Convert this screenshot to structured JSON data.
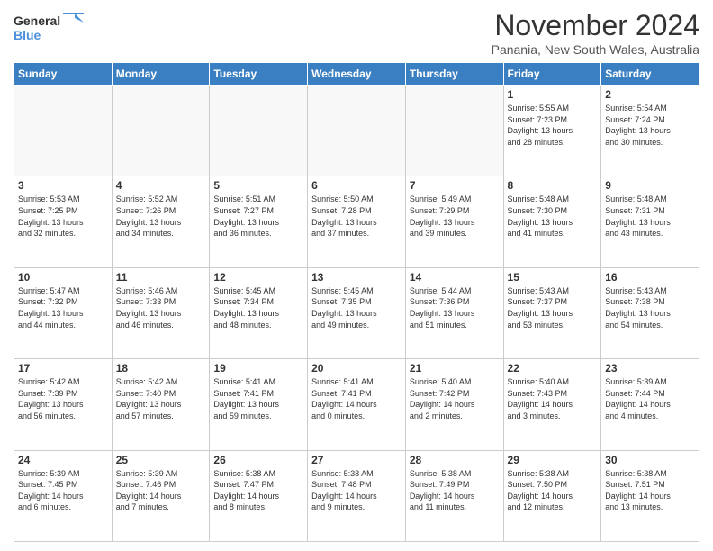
{
  "logo": {
    "line1": "General",
    "line2": "Blue"
  },
  "header": {
    "month": "November 2024",
    "location": "Panania, New South Wales, Australia"
  },
  "weekdays": [
    "Sunday",
    "Monday",
    "Tuesday",
    "Wednesday",
    "Thursday",
    "Friday",
    "Saturday"
  ],
  "weeks": [
    [
      {
        "day": "",
        "info": ""
      },
      {
        "day": "",
        "info": ""
      },
      {
        "day": "",
        "info": ""
      },
      {
        "day": "",
        "info": ""
      },
      {
        "day": "",
        "info": ""
      },
      {
        "day": "1",
        "info": "Sunrise: 5:55 AM\nSunset: 7:23 PM\nDaylight: 13 hours\nand 28 minutes."
      },
      {
        "day": "2",
        "info": "Sunrise: 5:54 AM\nSunset: 7:24 PM\nDaylight: 13 hours\nand 30 minutes."
      }
    ],
    [
      {
        "day": "3",
        "info": "Sunrise: 5:53 AM\nSunset: 7:25 PM\nDaylight: 13 hours\nand 32 minutes."
      },
      {
        "day": "4",
        "info": "Sunrise: 5:52 AM\nSunset: 7:26 PM\nDaylight: 13 hours\nand 34 minutes."
      },
      {
        "day": "5",
        "info": "Sunrise: 5:51 AM\nSunset: 7:27 PM\nDaylight: 13 hours\nand 36 minutes."
      },
      {
        "day": "6",
        "info": "Sunrise: 5:50 AM\nSunset: 7:28 PM\nDaylight: 13 hours\nand 37 minutes."
      },
      {
        "day": "7",
        "info": "Sunrise: 5:49 AM\nSunset: 7:29 PM\nDaylight: 13 hours\nand 39 minutes."
      },
      {
        "day": "8",
        "info": "Sunrise: 5:48 AM\nSunset: 7:30 PM\nDaylight: 13 hours\nand 41 minutes."
      },
      {
        "day": "9",
        "info": "Sunrise: 5:48 AM\nSunset: 7:31 PM\nDaylight: 13 hours\nand 43 minutes."
      }
    ],
    [
      {
        "day": "10",
        "info": "Sunrise: 5:47 AM\nSunset: 7:32 PM\nDaylight: 13 hours\nand 44 minutes."
      },
      {
        "day": "11",
        "info": "Sunrise: 5:46 AM\nSunset: 7:33 PM\nDaylight: 13 hours\nand 46 minutes."
      },
      {
        "day": "12",
        "info": "Sunrise: 5:45 AM\nSunset: 7:34 PM\nDaylight: 13 hours\nand 48 minutes."
      },
      {
        "day": "13",
        "info": "Sunrise: 5:45 AM\nSunset: 7:35 PM\nDaylight: 13 hours\nand 49 minutes."
      },
      {
        "day": "14",
        "info": "Sunrise: 5:44 AM\nSunset: 7:36 PM\nDaylight: 13 hours\nand 51 minutes."
      },
      {
        "day": "15",
        "info": "Sunrise: 5:43 AM\nSunset: 7:37 PM\nDaylight: 13 hours\nand 53 minutes."
      },
      {
        "day": "16",
        "info": "Sunrise: 5:43 AM\nSunset: 7:38 PM\nDaylight: 13 hours\nand 54 minutes."
      }
    ],
    [
      {
        "day": "17",
        "info": "Sunrise: 5:42 AM\nSunset: 7:39 PM\nDaylight: 13 hours\nand 56 minutes."
      },
      {
        "day": "18",
        "info": "Sunrise: 5:42 AM\nSunset: 7:40 PM\nDaylight: 13 hours\nand 57 minutes."
      },
      {
        "day": "19",
        "info": "Sunrise: 5:41 AM\nSunset: 7:41 PM\nDaylight: 13 hours\nand 59 minutes."
      },
      {
        "day": "20",
        "info": "Sunrise: 5:41 AM\nSunset: 7:41 PM\nDaylight: 14 hours\nand 0 minutes."
      },
      {
        "day": "21",
        "info": "Sunrise: 5:40 AM\nSunset: 7:42 PM\nDaylight: 14 hours\nand 2 minutes."
      },
      {
        "day": "22",
        "info": "Sunrise: 5:40 AM\nSunset: 7:43 PM\nDaylight: 14 hours\nand 3 minutes."
      },
      {
        "day": "23",
        "info": "Sunrise: 5:39 AM\nSunset: 7:44 PM\nDaylight: 14 hours\nand 4 minutes."
      }
    ],
    [
      {
        "day": "24",
        "info": "Sunrise: 5:39 AM\nSunset: 7:45 PM\nDaylight: 14 hours\nand 6 minutes."
      },
      {
        "day": "25",
        "info": "Sunrise: 5:39 AM\nSunset: 7:46 PM\nDaylight: 14 hours\nand 7 minutes."
      },
      {
        "day": "26",
        "info": "Sunrise: 5:38 AM\nSunset: 7:47 PM\nDaylight: 14 hours\nand 8 minutes."
      },
      {
        "day": "27",
        "info": "Sunrise: 5:38 AM\nSunset: 7:48 PM\nDaylight: 14 hours\nand 9 minutes."
      },
      {
        "day": "28",
        "info": "Sunrise: 5:38 AM\nSunset: 7:49 PM\nDaylight: 14 hours\nand 11 minutes."
      },
      {
        "day": "29",
        "info": "Sunrise: 5:38 AM\nSunset: 7:50 PM\nDaylight: 14 hours\nand 12 minutes."
      },
      {
        "day": "30",
        "info": "Sunrise: 5:38 AM\nSunset: 7:51 PM\nDaylight: 14 hours\nand 13 minutes."
      }
    ]
  ]
}
